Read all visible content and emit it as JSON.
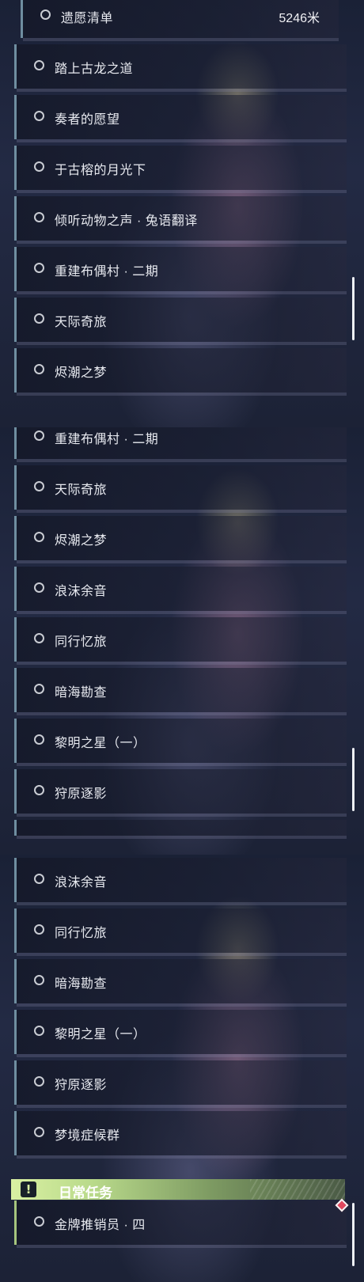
{
  "panel_1": {
    "items": [
      {
        "label": "遗愿清单",
        "distance": "5246米"
      },
      {
        "label": "踏上古龙之道"
      },
      {
        "label": "奏者的愿望"
      },
      {
        "label": "于古榕的月光下"
      },
      {
        "label": "倾听动物之声 · 兔语翻译"
      },
      {
        "label": "重建布偶村 · 二期"
      },
      {
        "label": "天际奇旅"
      },
      {
        "label": "烬潮之梦"
      }
    ]
  },
  "panel_2": {
    "items": [
      {
        "label": "重建布偶村 · 二期"
      },
      {
        "label": "天际奇旅"
      },
      {
        "label": "烬潮之梦"
      },
      {
        "label": "浪沫余音"
      },
      {
        "label": "同行忆旅"
      },
      {
        "label": "暗海勘查"
      },
      {
        "label": "黎明之星（一）"
      },
      {
        "label": "狩原逐影"
      }
    ]
  },
  "panel_3": {
    "items": [
      {
        "label": "浪沫余音"
      },
      {
        "label": "同行忆旅"
      },
      {
        "label": "暗海勘查"
      },
      {
        "label": "黎明之星（一）"
      },
      {
        "label": "狩原逐影"
      },
      {
        "label": "梦境症候群"
      }
    ],
    "daily_section": {
      "title": "日常任务",
      "items": [
        {
          "label": "金牌推销员 · 四"
        }
      ]
    }
  },
  "colors": {
    "accent_green": "#d9f0a2",
    "item_bar": "#6f8ea0",
    "marker_red": "#e0485e"
  }
}
